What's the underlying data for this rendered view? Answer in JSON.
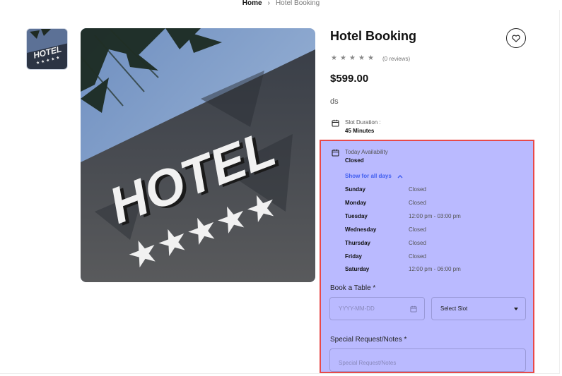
{
  "breadcrumb": {
    "home": "Home",
    "separator": "›",
    "current": "Hotel Booking"
  },
  "product": {
    "title": "Hotel Booking",
    "reviews": "(0 reviews)",
    "rating_stars": 0,
    "price": "$599.00",
    "description": "ds",
    "image_sign_text": "HOTEL"
  },
  "slot": {
    "label": "Slot Duration :",
    "value": "45 Minutes"
  },
  "availability": {
    "label": "Today Availability",
    "status": "Closed",
    "toggle_label": "Show for all days",
    "days": [
      {
        "day": "Sunday",
        "time": "Closed"
      },
      {
        "day": "Monday",
        "time": "Closed"
      },
      {
        "day": "Tuesday",
        "time": "12:00 pm - 03:00 pm"
      },
      {
        "day": "Wednesday",
        "time": "Closed"
      },
      {
        "day": "Thursday",
        "time": "Closed"
      },
      {
        "day": "Friday",
        "time": "Closed"
      },
      {
        "day": "Saturday",
        "time": "12:00 pm - 06:00 pm"
      }
    ]
  },
  "booking": {
    "label": "Book a Table *",
    "date_placeholder": "YYYY-MM-DD",
    "slot_value": "Select Slot",
    "notes_label": "Special Request/Notes *",
    "notes_placeholder": "Special Request/Notes"
  },
  "colors": {
    "highlight": "#babaff",
    "highlight_border": "#e84a4a",
    "link": "#3f5df0"
  },
  "icons": [
    "chevron-right-icon",
    "heart-icon",
    "star-icon",
    "calendar-icon",
    "chevron-up-icon",
    "caret-down-icon"
  ]
}
